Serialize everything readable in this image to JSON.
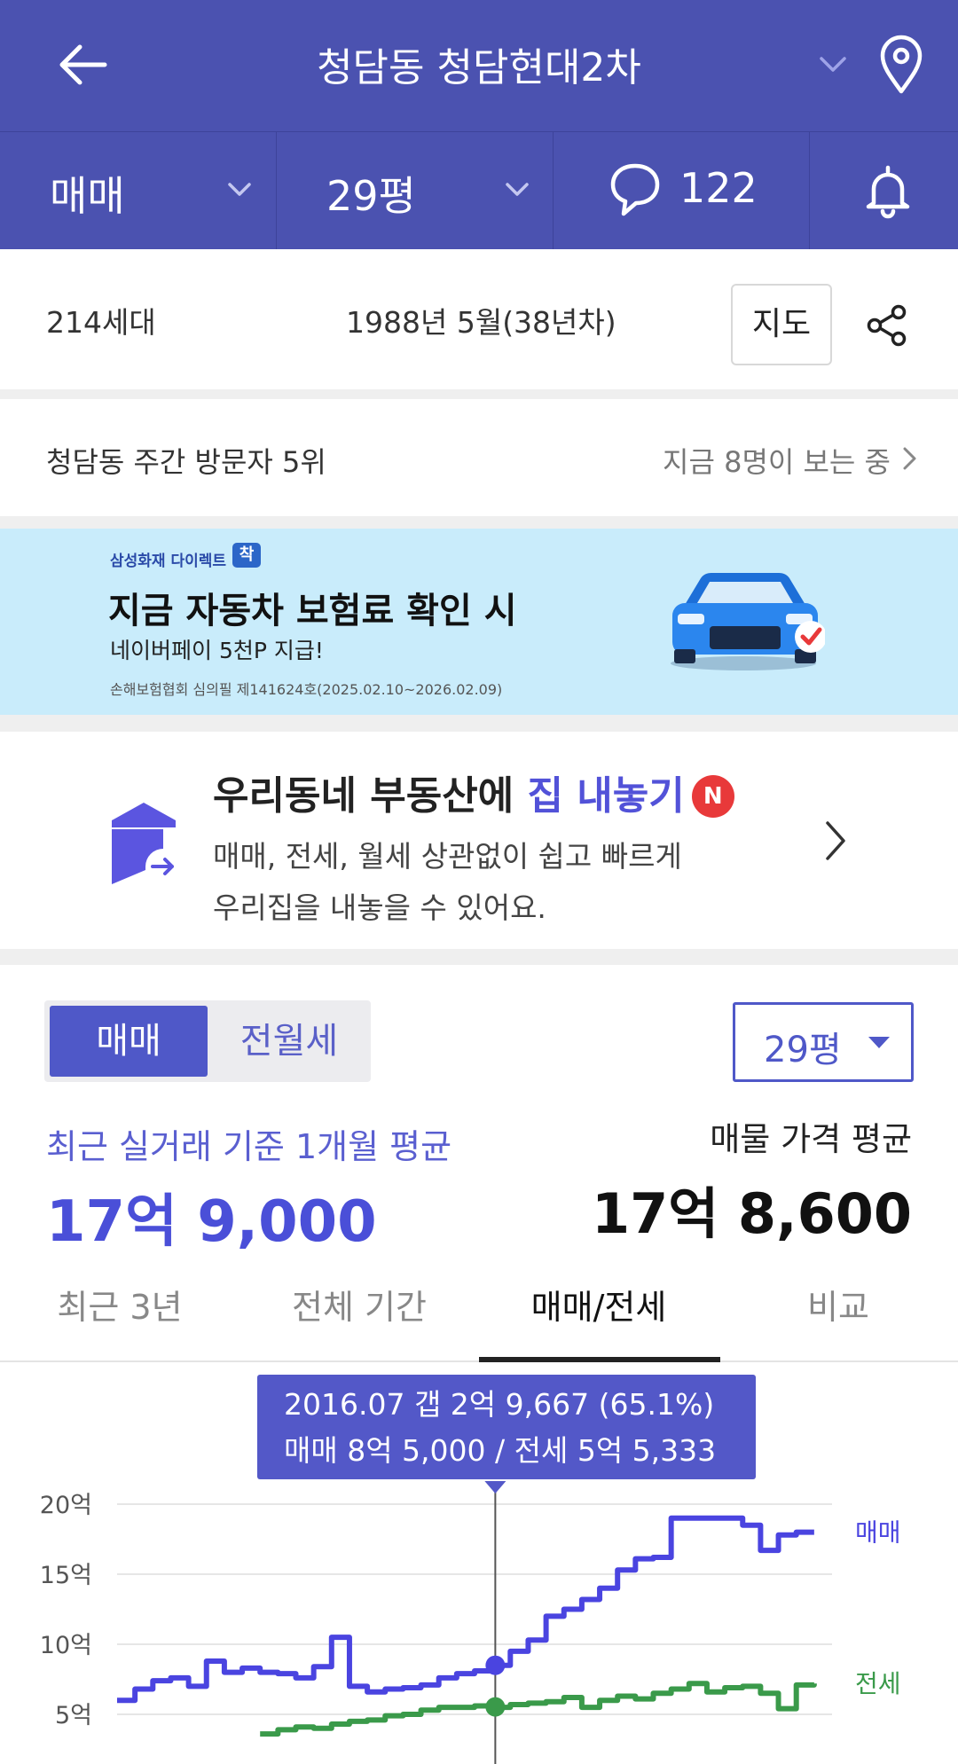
{
  "header": {
    "title": "청담동 청담현대2차",
    "back_icon": "arrow-left-icon",
    "location_icon": "map-pin-icon"
  },
  "subbar": {
    "trade_type": "매매",
    "size": "29평",
    "comment_count": "122"
  },
  "info": {
    "households": "214세대",
    "built": "1988년 5월(38년차)",
    "map_button": "지도"
  },
  "rank": {
    "label": "청담동 주간 방문자 5위",
    "viewers": "지금 8명이 보는 중"
  },
  "ad": {
    "brand": "삼성화재 다이렉트",
    "brand_mark": "착",
    "headline": "지금 자동차 보험료 확인 시",
    "sub": "네이버페이 5천P 지급!",
    "fine_print": "손해보험협회 심의필 제141624호(2025.02.10~2026.02.09)"
  },
  "sell": {
    "title_prefix": "우리동네 부동산에 ",
    "title_highlight": "집 내놓기",
    "badge": "N",
    "desc_line1": "매매, 전세, 월세 상관없이 쉽고 빠르게",
    "desc_line2": "우리집을 내놓을 수 있어요."
  },
  "price": {
    "seg_active": "매매",
    "seg_inactive": "전월세",
    "size_select": "29평",
    "recent_label": "최근 실거래 기준 1개월 평균",
    "recent_value": "17억 9,000",
    "ask_label": "매물 가격 평균",
    "ask_value": "17억 8,600"
  },
  "tabs": [
    "최근 3년",
    "전체 기간",
    "매매/전세",
    "비교"
  ],
  "active_tab": "매매/전세",
  "tooltip": {
    "line1": "2016.07  갭 2억 9,667 (65.1%)",
    "line2": "매매 8억 5,000 / 전세 5억 5,333"
  },
  "colors": {
    "header": "#4b52b0",
    "accent": "#4f58c8",
    "sale_line": "#4a44e0",
    "jeonse_line": "#3a9a4a"
  },
  "chart_data": {
    "type": "line",
    "ylabel_ticks": [
      "20억",
      "15억",
      "10억",
      "5억"
    ],
    "yticks": [
      20,
      15,
      10,
      5
    ],
    "ylim": [
      3.5,
      21.5
    ],
    "x_range": [
      "2006",
      "2026"
    ],
    "grid": true,
    "legend_placement": "right-inline",
    "series": [
      {
        "name": "매매",
        "color": "#4a44e0",
        "x": [
          2006.0,
          2006.5,
          2007.0,
          2007.5,
          2008.0,
          2008.5,
          2009.0,
          2009.5,
          2010.0,
          2010.5,
          2011.0,
          2011.5,
          2012.0,
          2012.5,
          2013.0,
          2013.5,
          2014.0,
          2014.5,
          2015.0,
          2015.5,
          2016.0,
          2016.5,
          2017.0,
          2017.5,
          2018.0,
          2018.5,
          2019.0,
          2019.5,
          2020.0,
          2020.5,
          2021.0,
          2021.5,
          2022.0,
          2022.5,
          2023.0,
          2023.5,
          2024.0,
          2024.5,
          2025.0,
          2025.5
        ],
        "values": [
          6.0,
          6.8,
          7.4,
          7.6,
          7.0,
          8.8,
          8.0,
          8.3,
          8.0,
          7.9,
          7.6,
          8.4,
          10.5,
          7.0,
          6.6,
          6.8,
          6.9,
          7.1,
          7.6,
          7.9,
          8.1,
          8.5,
          9.5,
          10.3,
          12.0,
          12.5,
          13.2,
          14.0,
          15.3,
          16.1,
          16.2,
          19.0,
          19.0,
          19.0,
          19.0,
          18.5,
          16.7,
          17.8,
          18.0,
          18.0
        ]
      },
      {
        "name": "전세",
        "color": "#3a9a4a",
        "x": [
          2010.0,
          2010.5,
          2011.0,
          2011.5,
          2012.0,
          2012.5,
          2013.0,
          2013.5,
          2014.0,
          2014.5,
          2015.0,
          2015.5,
          2016.0,
          2016.5,
          2017.0,
          2017.5,
          2018.0,
          2018.5,
          2019.0,
          2019.5,
          2020.0,
          2020.5,
          2021.0,
          2021.5,
          2022.0,
          2022.5,
          2023.0,
          2023.5,
          2024.0,
          2024.5,
          2025.0,
          2025.5
        ],
        "values": [
          3.6,
          3.9,
          4.1,
          4.0,
          4.3,
          4.5,
          4.6,
          4.9,
          5.0,
          5.3,
          5.5,
          5.5,
          5.6,
          5.5,
          5.7,
          5.8,
          5.9,
          6.2,
          5.5,
          6.0,
          6.3,
          6.1,
          6.5,
          6.8,
          7.2,
          6.6,
          6.9,
          7.0,
          6.5,
          5.4,
          7.1,
          7.2
        ]
      }
    ],
    "highlight": {
      "x": 2016.58,
      "sale": 8.5,
      "jeonse": 5.53
    }
  }
}
